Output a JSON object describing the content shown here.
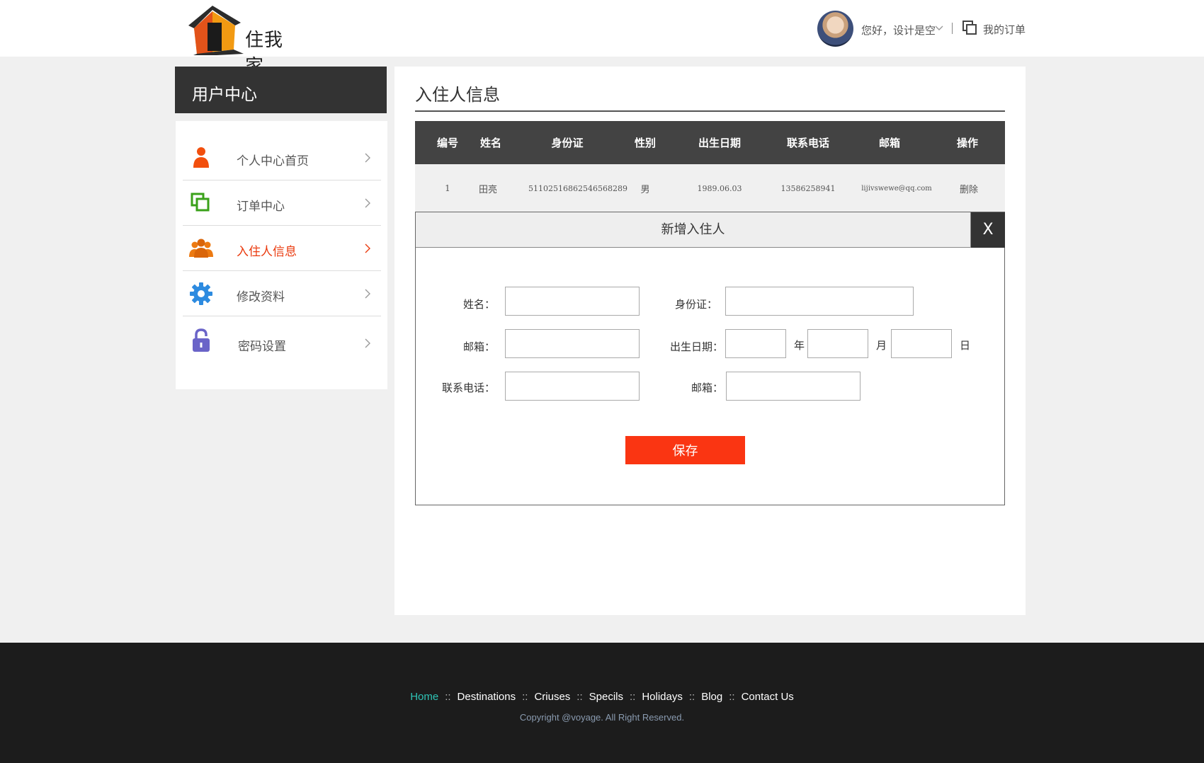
{
  "header": {
    "logo_text": "住我家",
    "greeting": "您好，设计是空",
    "my_orders": "我的订单"
  },
  "sidebar": {
    "title": "用户中心",
    "items": [
      {
        "label": "个人中心首页",
        "icon": "person-icon",
        "color": "#f24f0d"
      },
      {
        "label": "订单中心",
        "icon": "orders-icon",
        "color": "#3aa11a"
      },
      {
        "label": "入住人信息",
        "icon": "group-icon",
        "color": "#ec7a12",
        "active": true
      },
      {
        "label": "修改资料",
        "icon": "gear-icon",
        "color": "#2d8be0"
      },
      {
        "label": "密码设置",
        "icon": "lock-icon",
        "color": "#6a64c8"
      }
    ]
  },
  "main": {
    "title": "入住人信息",
    "table": {
      "headers": [
        "编号",
        "姓名",
        "身份证",
        "性别",
        "出生日期",
        "联系电话",
        "邮箱",
        "操作"
      ],
      "rows": [
        [
          "1",
          "田亮",
          "511025168625465682​89",
          "男",
          "1989.06.03",
          "13586258941",
          "lijivswewe@qq.com",
          "删除"
        ]
      ]
    }
  },
  "dialog": {
    "title": "新增入住人",
    "close": "X",
    "labels": {
      "name": "姓名：",
      "id_card": "身份证：",
      "email": "邮箱：",
      "birth": "出生日期：",
      "year": "年",
      "month": "月",
      "day": "日",
      "phone": "联系电话：",
      "email2": "邮箱："
    },
    "save": "保存"
  },
  "footer": {
    "nav": [
      "Home",
      "Destinations",
      "Criuses",
      "Specils",
      "Holidays",
      "Blog",
      "Contact Us"
    ],
    "separator": "::",
    "copyright": "Copyright @voyage. All Right Reserved."
  },
  "colors": {
    "accent": "#fa3512",
    "active_text": "#ea3a0e",
    "dark": "#333333",
    "footer_home": "#2ec4b6"
  }
}
